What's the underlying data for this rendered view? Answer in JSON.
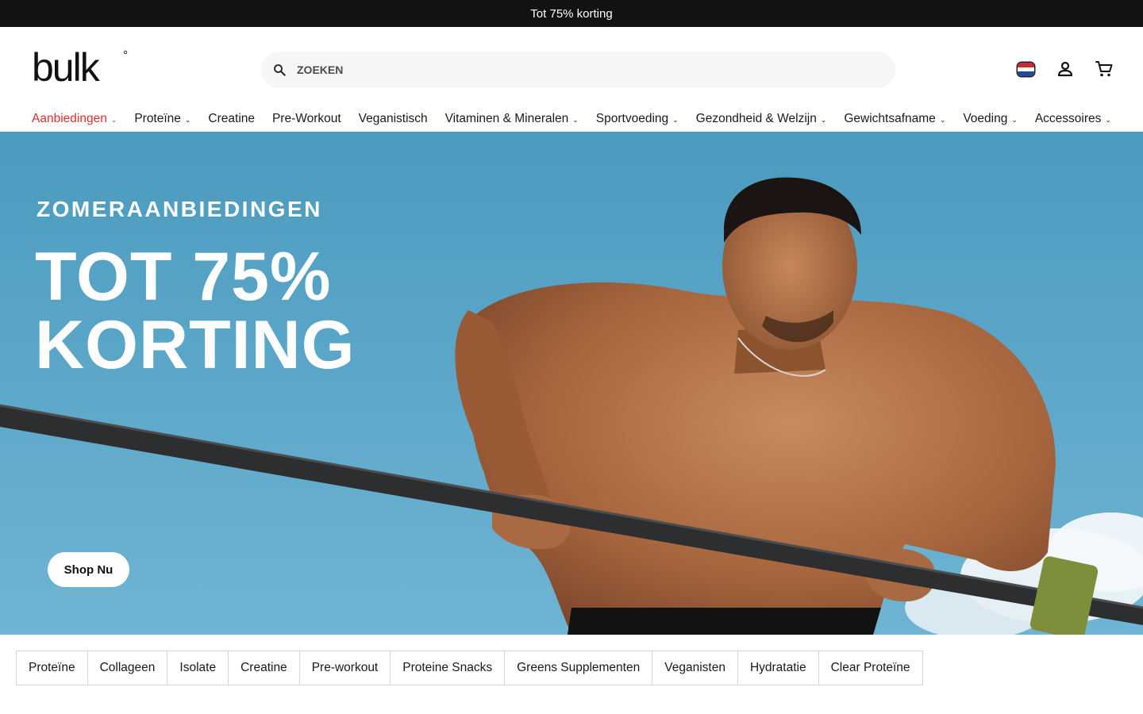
{
  "announcement": {
    "text": "Tot 75% korting"
  },
  "header": {
    "logo_text": "bulk",
    "search": {
      "placeholder": "ZOEKEN"
    },
    "country_flag": "netherlands-flag",
    "icons": [
      "search-icon",
      "flag-icon",
      "account-icon",
      "cart-icon"
    ]
  },
  "nav": {
    "items": [
      {
        "label": "Aanbiedingen",
        "dropdown": true,
        "highlight": "#e22c2c"
      },
      {
        "label": "Proteïne",
        "dropdown": true
      },
      {
        "label": "Creatine",
        "dropdown": false
      },
      {
        "label": "Pre-Workout",
        "dropdown": false
      },
      {
        "label": "Veganistisch",
        "dropdown": false
      },
      {
        "label": "Vitaminen & Mineralen",
        "dropdown": true
      },
      {
        "label": "Sportvoeding",
        "dropdown": true
      },
      {
        "label": "Gezondheid & Welzijn",
        "dropdown": true
      },
      {
        "label": "Gewichtsafname",
        "dropdown": true
      },
      {
        "label": "Voeding",
        "dropdown": true
      },
      {
        "label": "Accessoires",
        "dropdown": true
      }
    ]
  },
  "hero": {
    "eyebrow": "ZOMERAANBIEDINGEN",
    "title_line1": "TOT 75%",
    "title_line2": "KORTING",
    "cta_label": "Shop Nu",
    "background_color": "#5ba7c9"
  },
  "categories": {
    "items": [
      "Proteïne",
      "Collageen",
      "Isolate",
      "Creatine",
      "Pre-workout",
      "Proteine Snacks",
      "Greens Supplementen",
      "Veganisten",
      "Hydratatie",
      "Clear Proteïne"
    ]
  },
  "colors": {
    "announcement_bg": "#121212",
    "accent_red": "#e22c2c",
    "search_bg": "#f6f6f6"
  }
}
